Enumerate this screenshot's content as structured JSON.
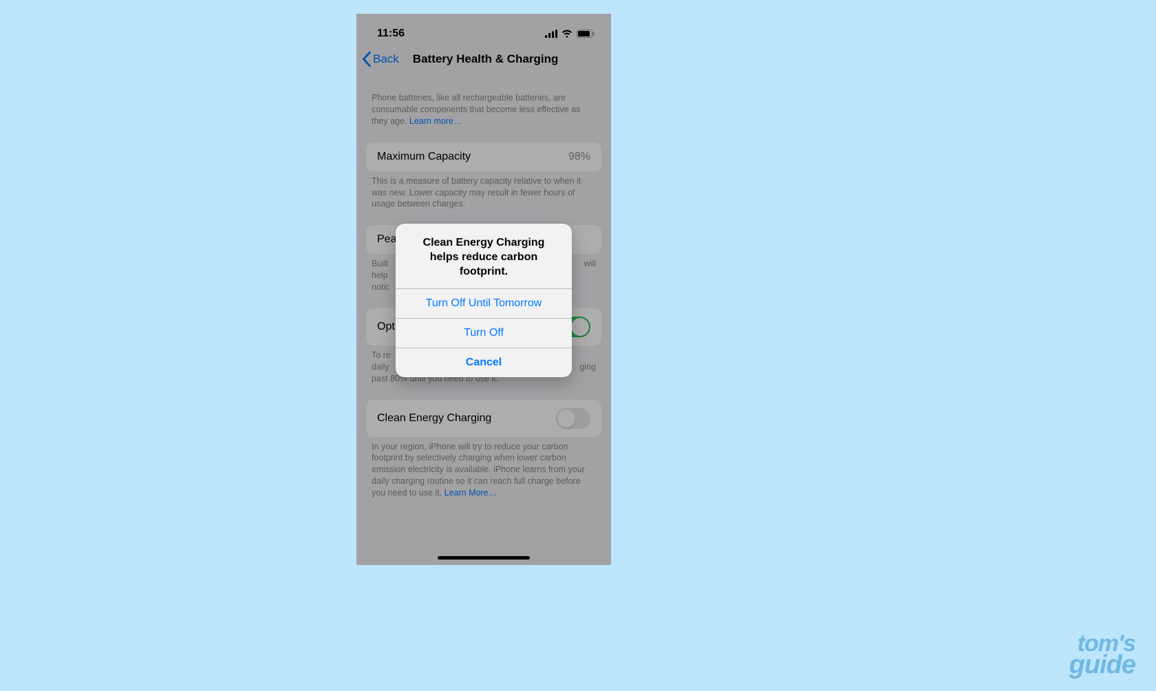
{
  "status": {
    "time": "11:56"
  },
  "nav": {
    "back": "Back",
    "title": "Battery Health & Charging"
  },
  "intro": {
    "text": "Phone batteries, like all rechargeable batteries, are consumable components that become less effective as they age. ",
    "link": "Learn more…"
  },
  "capacity": {
    "label": "Maximum Capacity",
    "value": "98%",
    "footer": "This is a measure of battery capacity relative to when it was new. Lower capacity may result in fewer hours of usage between charges."
  },
  "peak": {
    "label_prefix": "Pea",
    "footer_line1": "Built",
    "footer_line2": "help",
    "footer_line3": "notic",
    "footer_end": "will"
  },
  "optimized": {
    "label_prefix": "Opt",
    "footer_start": "To re",
    "footer_mid": "daily",
    "footer_end1": "ging",
    "footer_last": "past 80% until you need to use it."
  },
  "clean": {
    "label": "Clean Energy Charging",
    "footer": "In your region, iPhone will try to reduce your carbon footprint by selectively charging when lower carbon emission electricity is available. iPhone learns from your daily charging routine so it can reach full charge before you need to use it. ",
    "link": "Learn More…"
  },
  "modal": {
    "title": "Clean Energy Charging helps reduce carbon footprint.",
    "btn1": "Turn Off Until Tomorrow",
    "btn2": "Turn Off",
    "btn3": "Cancel"
  },
  "watermark": {
    "line1": "tom's",
    "line2": "guide"
  }
}
